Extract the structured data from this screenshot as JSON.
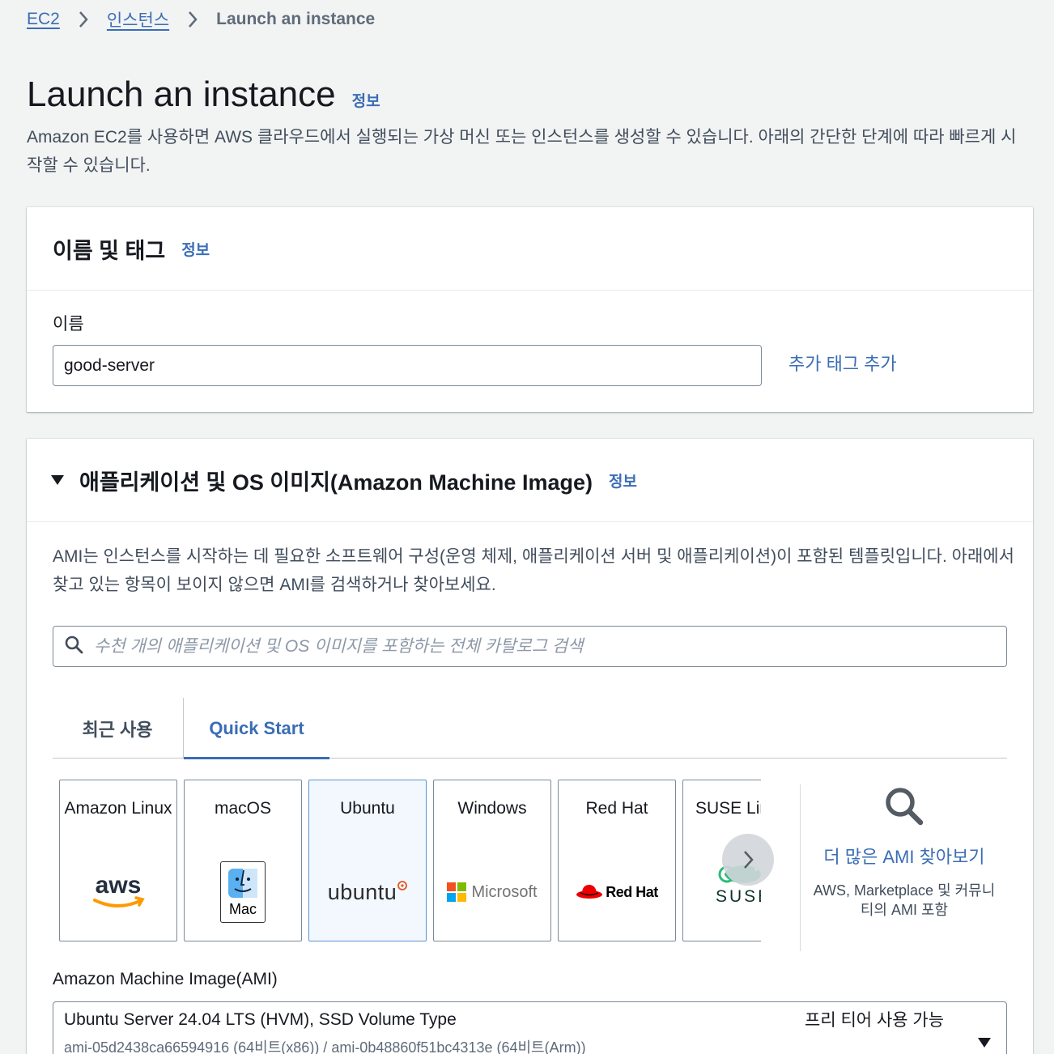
{
  "breadcrumb": {
    "items": [
      "EC2",
      "인스턴스"
    ],
    "current": "Launch an instance"
  },
  "page": {
    "title": "Launch an instance",
    "info": "정보",
    "description": "Amazon EC2를 사용하면 AWS 클라우드에서 실행되는 가상 머신 또는 인스턴스를 생성할 수 있습니다. 아래의 간단한 단계에 따라 빠르게 시작할 수 있습니다."
  },
  "name_panel": {
    "title": "이름 및 태그",
    "info": "정보",
    "field_label": "이름",
    "name_value": "good-server",
    "add_tags": "추가 태그 추가"
  },
  "ami_panel": {
    "title": "애플리케이션 및 OS 이미지(Amazon Machine Image)",
    "info": "정보",
    "description": "AMI는 인스턴스를 시작하는 데 필요한 소프트웨어 구성(운영 체제, 애플리케이션 서버 및 애플리케이션)이 포함된 템플릿입니다. 아래에서 찾고 있는 항목이 보이지 않으면 AMI를 검색하거나 찾아보세요.",
    "search_placeholder": "수천 개의 애플리케이션 및 OS 이미지를 포함하는 전체 카탈로그 검색",
    "tabs": [
      "최근 사용",
      "Quick Start"
    ],
    "active_tab": "Quick Start",
    "os_options": [
      {
        "name": "Amazon Linux",
        "logo": "aws-logo",
        "logo_text": "aws"
      },
      {
        "name": "macOS",
        "logo": "mac-finder-logo",
        "logo_text": "Mac"
      },
      {
        "name": "Ubuntu",
        "logo": "ubuntu-logo",
        "logo_text": "ubuntu"
      },
      {
        "name": "Windows",
        "logo": "microsoft-logo",
        "logo_text": "Microsoft"
      },
      {
        "name": "Red Hat",
        "logo": "redhat-logo",
        "logo_text": "Red Hat"
      },
      {
        "name": "SUSE Linux",
        "logo": "suse-logo",
        "logo_text": "SUSE"
      }
    ],
    "selected_os": "Ubuntu",
    "browse_more": "더 많은 AMI 찾아보기",
    "browse_more_sub": "AWS, Marketplace 및 커뮤니티의 AMI 포함",
    "ami_label": "Amazon Machine Image(AMI)",
    "ami_selected_name": "Ubuntu Server 24.04 LTS (HVM), SSD Volume Type",
    "ami_selected_ids": "ami-05d2438ca66594916 (64비트(x86)) / ami-0b48860f51bc4313e (64비트(Arm))",
    "ami_free_tier": "프리 티어 사용 가능"
  },
  "colors": {
    "link": "#3a6db5",
    "selected_card_bg": "#f2f8fd",
    "page_bg": "#f2f3f3"
  }
}
